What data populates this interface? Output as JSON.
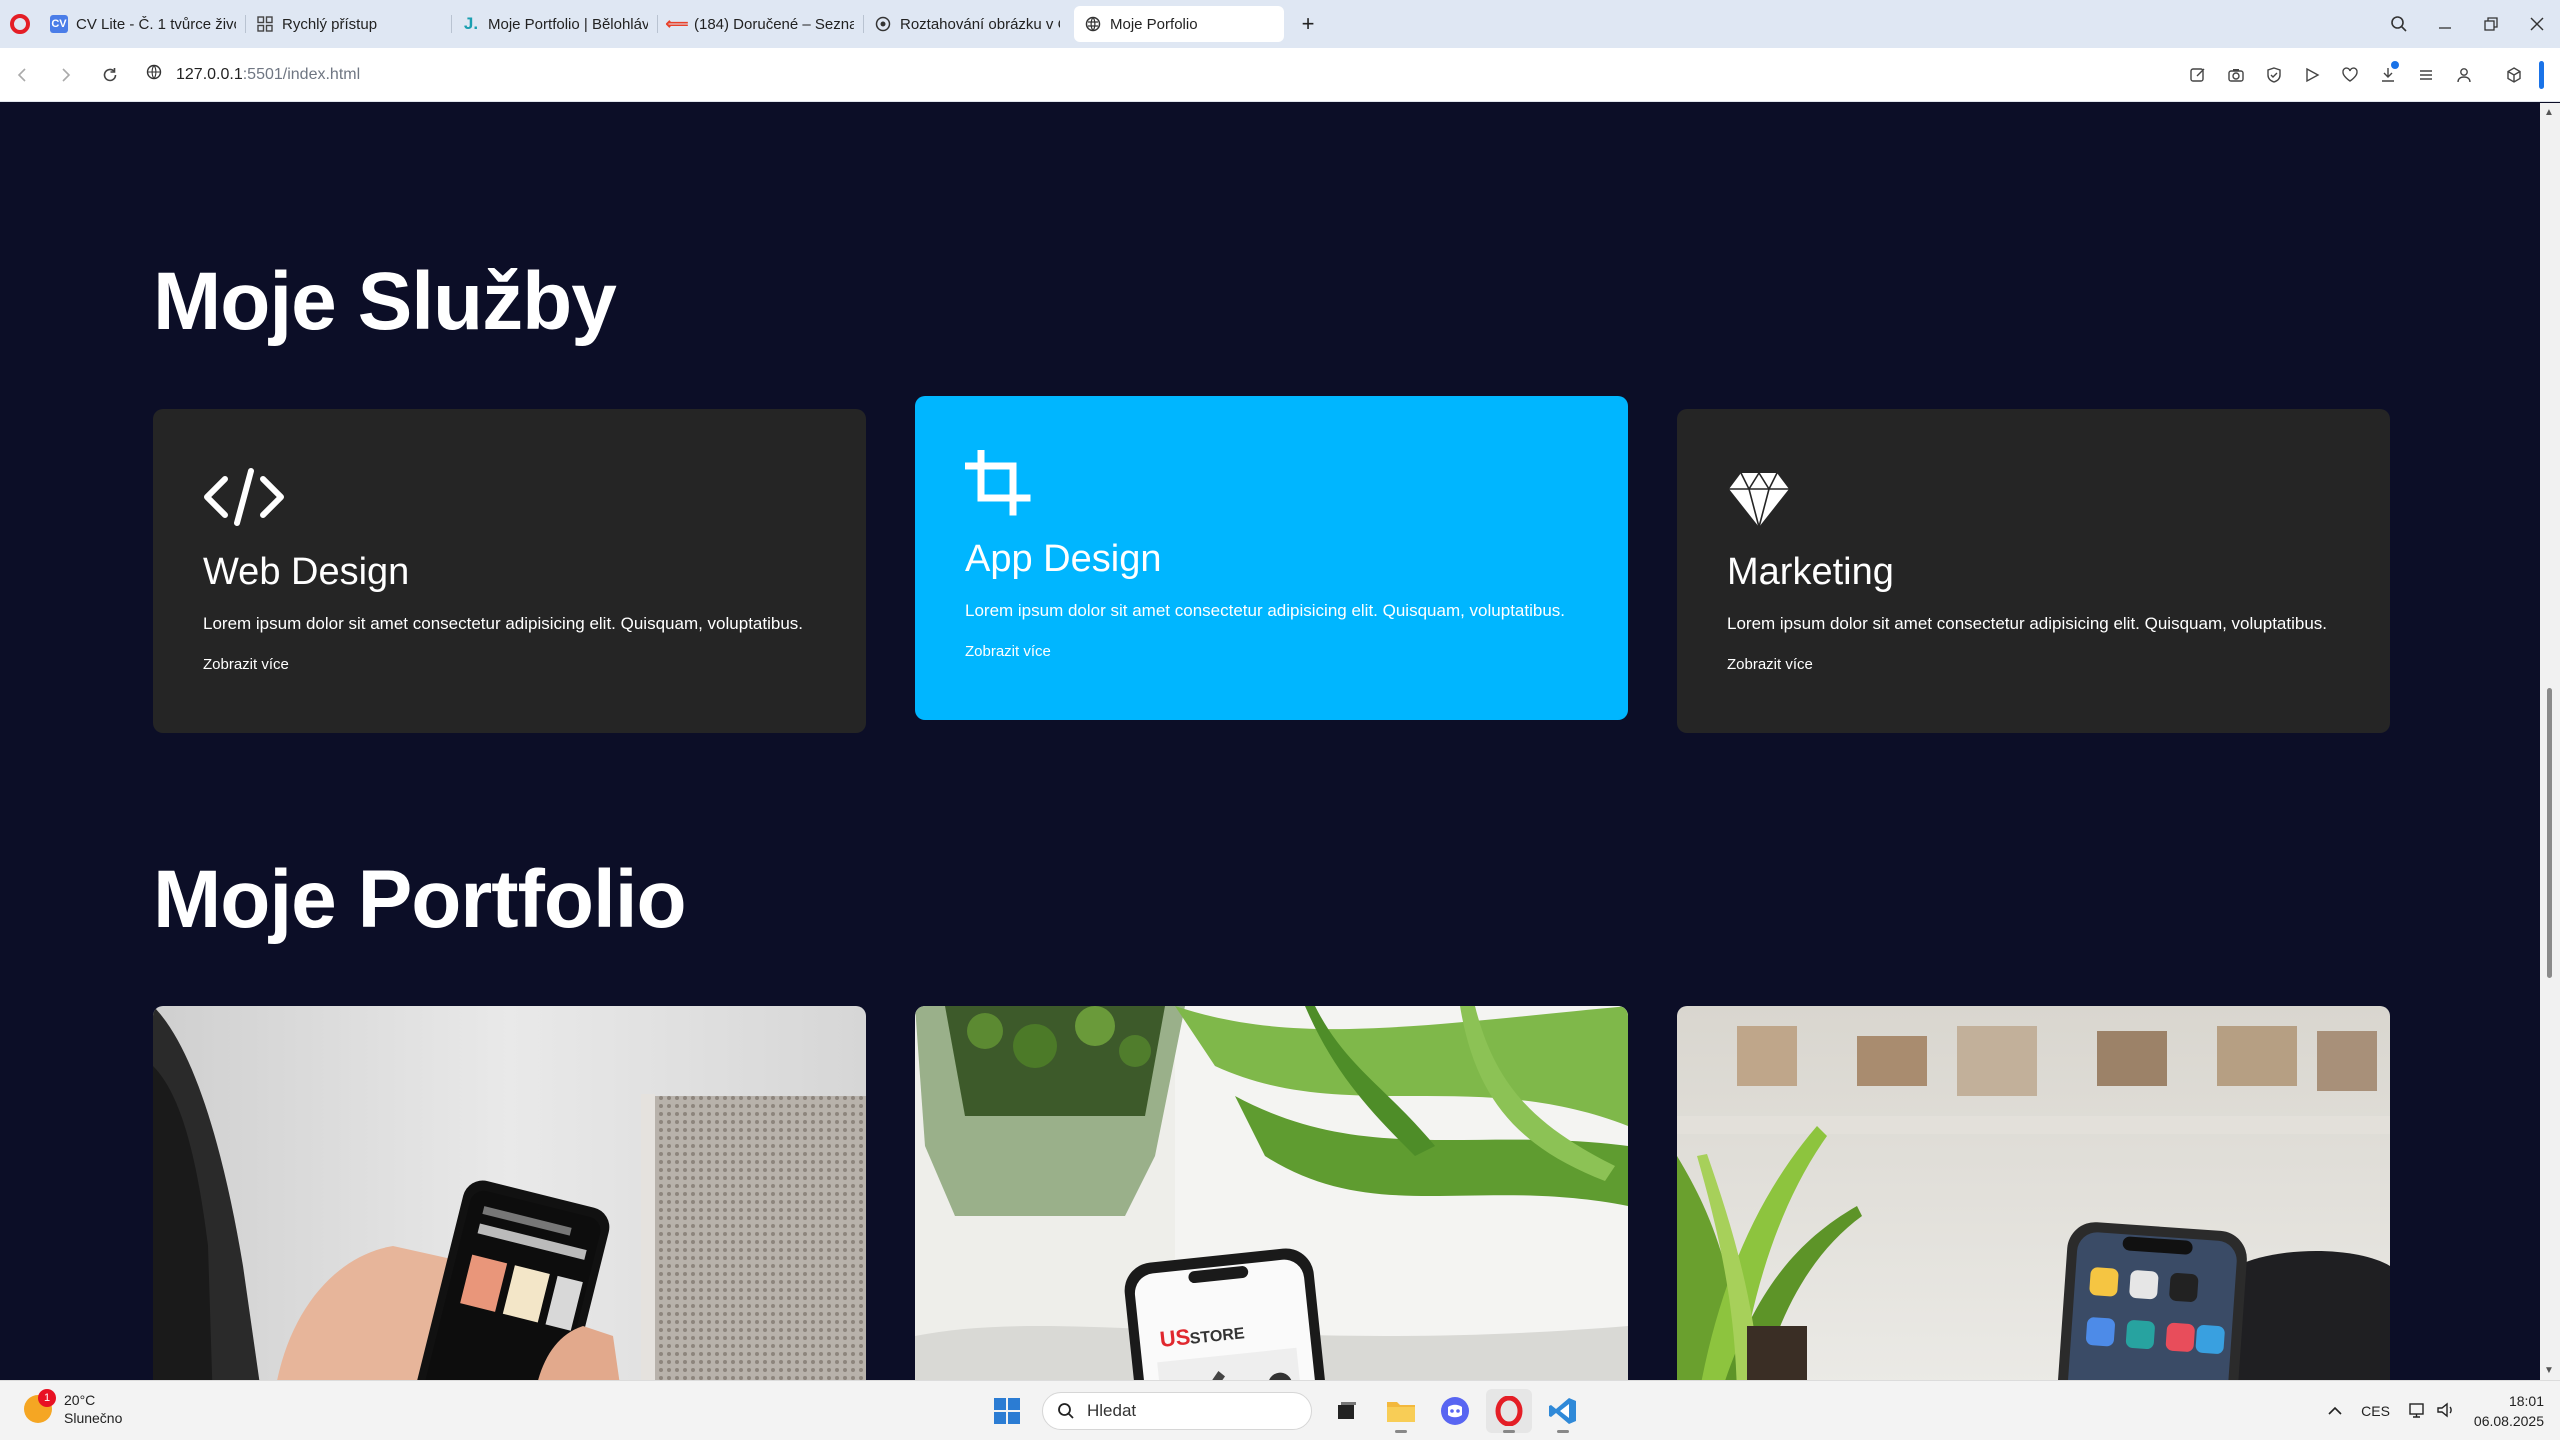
{
  "browser": {
    "tabs": [
      {
        "title": "CV Lite - Č. 1 tvůrce životopisů",
        "icon": "cv-icon"
      },
      {
        "title": "Rychlý přístup",
        "icon": "grid-icon"
      },
      {
        "title": "Moje Portfolio | Bělohlávek",
        "icon": "j-icon"
      },
      {
        "title": "(184) Doručené – Seznam",
        "icon": "seznam-icon"
      },
      {
        "title": "Roztahování obrázku v CSS",
        "icon": "web-icon"
      },
      {
        "title": "Moje Porfolio",
        "icon": "globe-icon",
        "active": true
      }
    ],
    "url_host": "127.0.0.1",
    "url_rest": ":5501/index.html"
  },
  "page": {
    "services_title": "Moje Služby",
    "services": [
      {
        "title": "Web Design",
        "text": "Lorem ipsum dolor sit amet consectetur adipisicing elit. Quisquam, voluptatibus.",
        "link": "Zobrazit více",
        "icon": "code-icon"
      },
      {
        "title": "App Design",
        "text": "Lorem ipsum dolor sit amet consectetur adipisicing elit. Quisquam, voluptatibus.",
        "link": "Zobrazit více",
        "icon": "crop-icon"
      },
      {
        "title": "Marketing",
        "text": "Lorem ipsum dolor sit amet consectetur adipisicing elit. Quisquam, voluptatibus.",
        "link": "Zobrazit více",
        "icon": "diamond-icon"
      }
    ],
    "portfolio_title": "Moje Portfolio",
    "portfolio_images": [
      "phone-in-hand-photo",
      "phone-with-plant-photo",
      "phone-on-desk-photo"
    ]
  },
  "taskbar": {
    "weather_temp": "20°C",
    "weather_desc": "Slunečno",
    "weather_badge": "1",
    "search_placeholder": "Hledat",
    "lang": "CES",
    "time": "18:01",
    "date": "06.08.2025"
  },
  "colors": {
    "page_bg": "#0c0e27",
    "card_bg": "#252525",
    "card_active": "#00b6ff"
  }
}
